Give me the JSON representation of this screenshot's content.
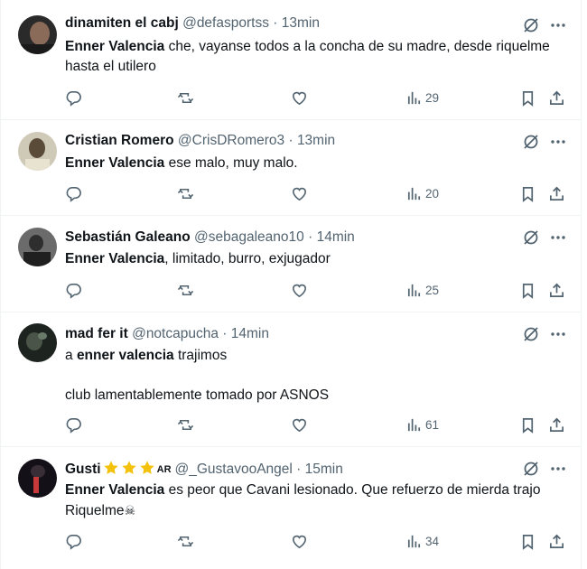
{
  "tweets": [
    {
      "name": "dinamiten el cabj",
      "handle": "@defasportss",
      "dot": "·",
      "time": "13min",
      "mention": "Enner Valencia",
      "text_before": "",
      "text_after": " che, vayanse todos a la concha de su madre, desde riquelme hasta el utilero",
      "line2": "",
      "views": "29"
    },
    {
      "name": "Cristian Romero",
      "handle": "@CrisDRomero3",
      "dot": "·",
      "time": "13min",
      "mention": "Enner Valencia",
      "text_before": "",
      "text_after": " ese malo, muy malo.",
      "line2": "",
      "views": "20"
    },
    {
      "name": "Sebastián Galeano",
      "handle": "@sebagaleano10",
      "dot": "·",
      "time": "14min",
      "mention": "Enner Valencia",
      "text_before": "",
      "text_after": ", limitado, burro, exjugador",
      "line2": "",
      "views": "25"
    },
    {
      "name": "mad fer it",
      "handle": "@notcapucha",
      "dot": "·",
      "time": "14min",
      "mention": "enner valencia",
      "text_before": "a ",
      "text_after": " trajimos",
      "line2": "club lamentablemente tomado por ASNOS",
      "views": "61"
    },
    {
      "name": "Gusti",
      "handle": "@_GustavooAngel",
      "dot": "·",
      "time": "15min",
      "flag": "AR",
      "mention": "Enner Valencia",
      "text_before": "",
      "text_after": " es peor que Cavani lesionado. Que refuerzo de mierda trajo Riquelme",
      "emoji": "☠",
      "line2": "",
      "views": "34"
    }
  ],
  "colors": {
    "text": "#0f1419",
    "secondary": "#536471",
    "border": "#eff3f4",
    "star": "#f4c20d"
  },
  "icons": [
    "reply-icon",
    "retweet-icon",
    "like-icon",
    "views-icon",
    "bookmark-icon",
    "share-icon",
    "grok-icon",
    "more-icon",
    "star-icon"
  ]
}
